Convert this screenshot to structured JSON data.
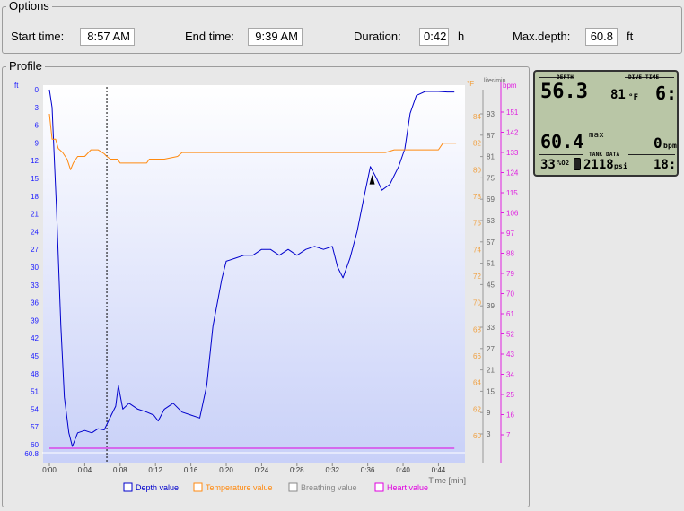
{
  "options": {
    "title": "Options",
    "start_label": "Start time:",
    "start_value": "8:57 AM",
    "end_label": "End time:",
    "end_value": "9:39 AM",
    "duration_label": "Duration:",
    "duration_value": "0:42",
    "duration_unit": "h",
    "maxdepth_label": "Max.depth:",
    "maxdepth_value": "60.8",
    "maxdepth_unit": "ft"
  },
  "profile": {
    "title": "Profile"
  },
  "chart_data": {
    "type": "line",
    "xlabel": "Time [min]",
    "x_ticks": [
      "0:00",
      "0:04",
      "0:08",
      "0:12",
      "0:16",
      "0:20",
      "0:24",
      "0:28",
      "0:32",
      "0:36",
      "0:40",
      "0:44"
    ],
    "xlim": [
      0,
      47
    ],
    "axes": {
      "depth": {
        "unit": "ft",
        "range": [
          0,
          60.8
        ],
        "inverted": true,
        "ticks": [
          "0",
          "3",
          "6",
          "9",
          "12",
          "15",
          "18",
          "21",
          "24",
          "27",
          "30",
          "33",
          "36",
          "39",
          "42",
          "45",
          "48",
          "51",
          "54",
          "57",
          "60"
        ],
        "max_label": "60.8",
        "color": "#1a1aff"
      },
      "temperature": {
        "unit": "°F",
        "ticks": [
          "84",
          "82",
          "80",
          "78",
          "76",
          "74",
          "72",
          "70",
          "68",
          "66",
          "64",
          "62",
          "60"
        ],
        "color": "#f0a040"
      },
      "breathing": {
        "unit": "liter/min",
        "ticks": [
          "93",
          "87",
          "81",
          "75",
          "69",
          "63",
          "57",
          "51",
          "45",
          "39",
          "33",
          "27",
          "21",
          "15",
          "9",
          "3"
        ],
        "color": "#666666"
      },
      "heart": {
        "unit": "bpm",
        "ticks": [
          "151",
          "142",
          "133",
          "124",
          "115",
          "106",
          "97",
          "88",
          "79",
          "70",
          "61",
          "52",
          "43",
          "34",
          "25",
          "16",
          "7"
        ],
        "color": "#e020e0"
      }
    },
    "series": [
      {
        "name": "Depth value",
        "color": "#0000cc",
        "points": [
          [
            0,
            0
          ],
          [
            0.3,
            3
          ],
          [
            0.8,
            20
          ],
          [
            1.3,
            40
          ],
          [
            1.7,
            52
          ],
          [
            2.2,
            58
          ],
          [
            2.6,
            60.3
          ],
          [
            3.2,
            58
          ],
          [
            4,
            57.6
          ],
          [
            4.8,
            58
          ],
          [
            5.5,
            57.3
          ],
          [
            6.2,
            57.5
          ],
          [
            7,
            55
          ],
          [
            7.5,
            53.5
          ],
          [
            7.8,
            50
          ],
          [
            8.3,
            54
          ],
          [
            9,
            53
          ],
          [
            10,
            54
          ],
          [
            11,
            54.5
          ],
          [
            11.8,
            55
          ],
          [
            12.3,
            56
          ],
          [
            13,
            54
          ],
          [
            14,
            53
          ],
          [
            15,
            54.5
          ],
          [
            16,
            55
          ],
          [
            17,
            55.5
          ],
          [
            17.8,
            50
          ],
          [
            18.5,
            40
          ],
          [
            19.5,
            32
          ],
          [
            20,
            29
          ],
          [
            21,
            28.5
          ],
          [
            22,
            28
          ],
          [
            23,
            28
          ],
          [
            24,
            27
          ],
          [
            25,
            27
          ],
          [
            26,
            28
          ],
          [
            27,
            27
          ],
          [
            28,
            28
          ],
          [
            29,
            27
          ],
          [
            30,
            26.5
          ],
          [
            31,
            27
          ],
          [
            32,
            26.5
          ],
          [
            32.6,
            30
          ],
          [
            33.2,
            31.8
          ],
          [
            34,
            28.5
          ],
          [
            34.8,
            24
          ],
          [
            35.6,
            18
          ],
          [
            36.3,
            13
          ],
          [
            37,
            15
          ],
          [
            37.6,
            17
          ],
          [
            38.5,
            16
          ],
          [
            39.5,
            13
          ],
          [
            40.2,
            10
          ],
          [
            40.8,
            4
          ],
          [
            41.5,
            1
          ],
          [
            42.5,
            0.3
          ],
          [
            44,
            0.3
          ],
          [
            45,
            0.4
          ],
          [
            45.8,
            0.4
          ]
        ]
      },
      {
        "name": "Temperature value",
        "color": "#ff8a10",
        "points": [
          [
            0,
            84.2
          ],
          [
            0.3,
            82.3
          ],
          [
            0.7,
            82.3
          ],
          [
            1,
            81.6
          ],
          [
            1.5,
            81.3
          ],
          [
            2,
            80.8
          ],
          [
            2.4,
            80
          ],
          [
            2.7,
            80.5
          ],
          [
            3.2,
            81
          ],
          [
            4,
            81
          ],
          [
            4.7,
            81.5
          ],
          [
            5.5,
            81.5
          ],
          [
            6.2,
            81.2
          ],
          [
            6.5,
            81
          ],
          [
            6.9,
            80.8
          ],
          [
            7.7,
            80.8
          ],
          [
            8,
            80.5
          ],
          [
            9,
            80.5
          ],
          [
            10,
            80.5
          ],
          [
            11,
            80.5
          ],
          [
            11.3,
            80.8
          ],
          [
            12.3,
            80.8
          ],
          [
            13,
            80.8
          ],
          [
            14.5,
            81
          ],
          [
            15,
            81.3
          ],
          [
            16,
            81.3
          ],
          [
            17.5,
            81.3
          ],
          [
            30,
            81.3
          ],
          [
            38,
            81.3
          ],
          [
            39,
            81.5
          ],
          [
            42,
            81.5
          ],
          [
            44,
            81.5
          ],
          [
            44.5,
            82
          ],
          [
            46,
            82
          ]
        ]
      },
      {
        "name": "Breathing value",
        "color": "#888888",
        "points": []
      },
      {
        "name": "Heart value",
        "color": "#e000e0",
        "points": [
          [
            0,
            2
          ],
          [
            45.8,
            2
          ]
        ]
      }
    ],
    "marker_time": 6.5,
    "legend": [
      "Depth value",
      "Temperature value",
      "Breathing value",
      "Heart value"
    ],
    "legend_colors": [
      "#0000cc",
      "#ff8a10",
      "#888888",
      "#e000e0"
    ]
  },
  "lcd": {
    "depth_label": "DEPTH",
    "depth_value": "56.3",
    "temp_value": "81",
    "temp_unit": "°F",
    "divetime_label": "DIVE TIME",
    "divetime_value": "6:",
    "max_value": "60.4",
    "max_label": "max",
    "bpm_value": "0",
    "bpm_unit": "bpm",
    "o2_value": "33",
    "o2_unit": "%O2",
    "tank_label": "TANK DATA",
    "tank_value": "2118",
    "tank_unit": "psi",
    "tank_time": "18:"
  }
}
